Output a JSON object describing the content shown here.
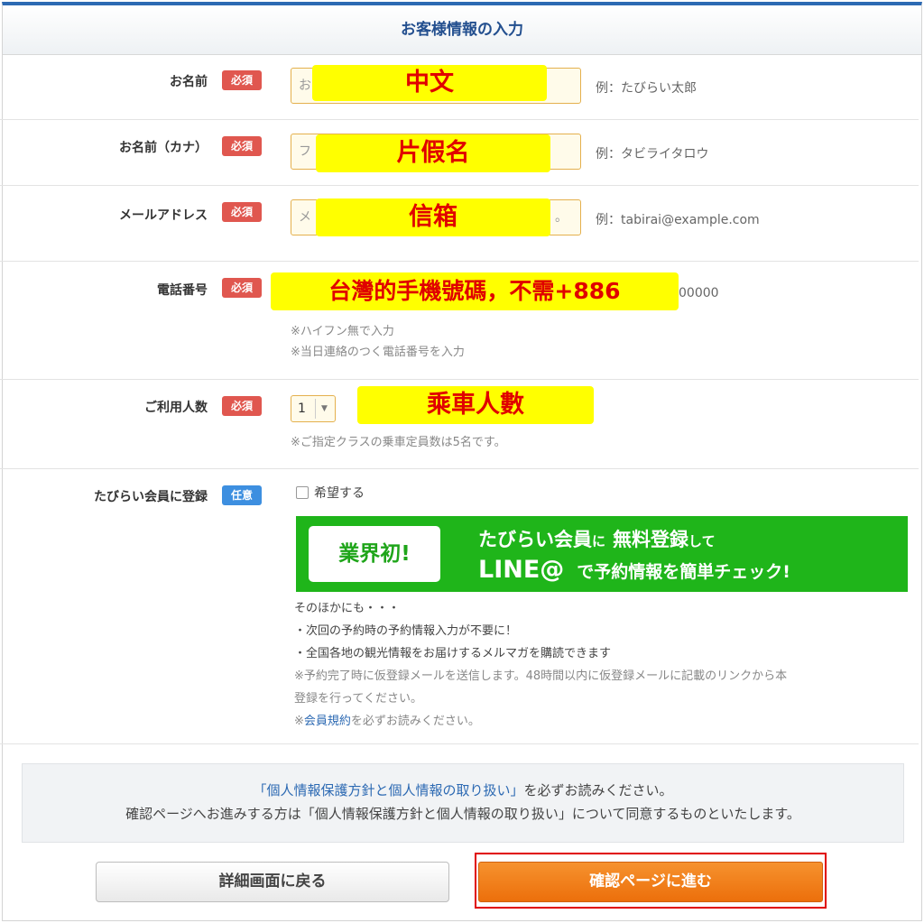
{
  "section_title": "お客様情報の入力",
  "badges": {
    "required": "必須",
    "optional": "任意"
  },
  "fields": {
    "name": {
      "label": "お名前",
      "placeholder_visible": "お",
      "overlay": "中文",
      "example": "例：たびらい太郎"
    },
    "kana": {
      "label": "お名前（カナ）",
      "placeholder_visible": "フ",
      "overlay": "片假名",
      "example": "例：タビライタロウ"
    },
    "email": {
      "label": "メールアドレス",
      "placeholder_visible_start": "メ",
      "placeholder_visible_end": "。",
      "overlay": "信箱",
      "example": "例：tabirai@example.com"
    },
    "phone": {
      "label": "電話番号",
      "overlay": "台灣的手機號碼，不需+886",
      "example_tail": "00000",
      "notes": [
        "※ハイフン無で入力",
        "※当日連絡のつく電話番号を入力"
      ]
    },
    "passengers": {
      "label": "ご利用人数",
      "value": "1",
      "overlay": "乘車人數",
      "note": "※ご指定クラスの乗車定員数は5名です。"
    }
  },
  "member": {
    "label": "たびらい会員に登録",
    "checkbox_label": "希望する",
    "banner": {
      "badge": "業界初!",
      "line1_a": "たびらい会員",
      "line1_b": "に",
      "line1_c": "無料登録",
      "line1_d": "して",
      "line2_a": "LINE@",
      "line2_b": "で予約情報を簡単チェック!"
    },
    "lines": [
      "そのほかにも・・・",
      "・次回の予約時の予約情報入力が不要に！",
      "・全国各地の観光情報をお届けするメルマガを購読できます"
    ],
    "gray_notes": [
      "※予約完了時に仮登録メールを送信します。48時間以内に仮登録メールに記載のリンクから本",
      "登録を行ってください。"
    ],
    "terms_prefix": "※",
    "terms_link": "会員規約",
    "terms_suffix": "を必ずお読みください。"
  },
  "privacy": {
    "link": "「個人情報保護方針と個人情報の取り扱い」",
    "line1_suffix": "を必ずお読みください。",
    "line2": "確認ページへお進みする方は「個人情報保護方針と個人情報の取り扱い」について同意するものといたします。"
  },
  "buttons": {
    "back": "詳細画面に戻る",
    "next": "確認ページに進む"
  },
  "colors": {
    "accent_blue": "#2d6ab3",
    "required_red": "#e0574f",
    "optional_blue": "#3d8fe0",
    "line_green": "#1fb51a",
    "next_orange": "#ec6f0b",
    "highlight_yellow": "#ffff00",
    "annotation_red": "#e00000"
  }
}
